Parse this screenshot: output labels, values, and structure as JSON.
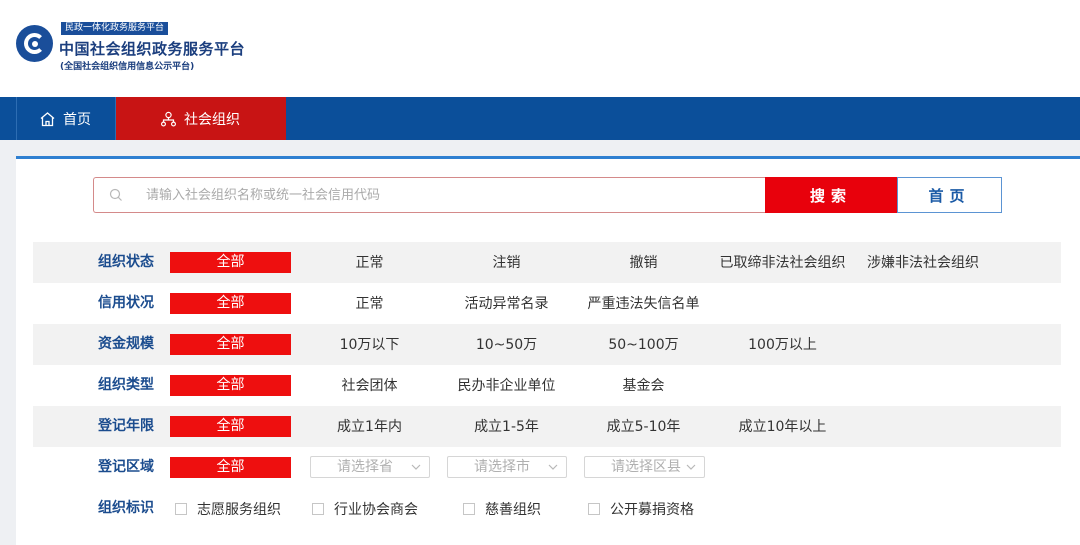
{
  "header": {
    "tag": "民政一体化政务服务平台",
    "title": "中国社会组织政务服务平台",
    "subtitle": "(全国社会组织信用信息公示平台)"
  },
  "nav": {
    "home": "首页",
    "org": "社会组织"
  },
  "search": {
    "placeholder": "请输入社会组织名称或统一社会信用代码",
    "value": "",
    "button": "搜索",
    "home_button": "首页"
  },
  "filters": {
    "all_label": "全部",
    "status": {
      "label": "组织状态",
      "options": [
        "正常",
        "注销",
        "撤销",
        "已取缔非法社会组织",
        "涉嫌非法社会组织"
      ]
    },
    "credit": {
      "label": "信用状况",
      "options": [
        "正常",
        "活动异常名录",
        "严重违法失信名单"
      ]
    },
    "capital": {
      "label": "资金规模",
      "options": [
        "10万以下",
        "10~50万",
        "50~100万",
        "100万以上"
      ]
    },
    "type": {
      "label": "组织类型",
      "options": [
        "社会团体",
        "民办非企业单位",
        "基金会"
      ]
    },
    "years": {
      "label": "登记年限",
      "options": [
        "成立1年内",
        "成立1-5年",
        "成立5-10年",
        "成立10年以上"
      ]
    },
    "region": {
      "label": "登记区域",
      "selects": [
        "请选择省",
        "请选择市",
        "请选择区县"
      ]
    },
    "mark": {
      "label": "组织标识",
      "checkboxes": [
        "志愿服务组织",
        "行业协会商会",
        "慈善组织",
        "公开募捐资格"
      ]
    }
  },
  "colors": {
    "nav_bg": "#0b4f9a",
    "accent_red": "#e8010c",
    "label_blue": "#1b4c8e"
  }
}
